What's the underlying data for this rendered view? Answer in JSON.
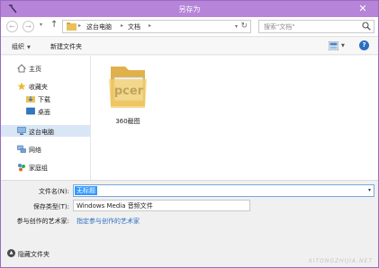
{
  "window": {
    "title": "另存为",
    "close_glyph": "✕"
  },
  "address": {
    "back_glyph": "←",
    "forward_glyph": "→",
    "dropdown_glyph": "▾",
    "up_glyph": "↑",
    "path": [
      "这台电脑",
      "文档"
    ],
    "separator_glyph": "▸",
    "refresh_glyph": "↻"
  },
  "search": {
    "placeholder": "搜索\"文档\""
  },
  "toolbar": {
    "organize": "组织",
    "new_folder": "新建文件夹",
    "caret_glyph": "▼",
    "help_glyph": "?"
  },
  "nav": {
    "favorites": [
      {
        "label": "主页",
        "icon": "home-icon"
      },
      {
        "label": "收藏夹",
        "icon": "star-icon"
      },
      {
        "label": "下载",
        "icon": "download-folder-icon"
      },
      {
        "label": "桌面",
        "icon": "desktop-icon"
      }
    ],
    "this_pc": "这台电脑",
    "network": "网络",
    "homegroup": "家庭组"
  },
  "files": [
    {
      "name": "360截图",
      "thumb_text": "pcer"
    }
  ],
  "form": {
    "filename_label": "文件名(N):",
    "filename_value": "无标题",
    "filetype_label": "保存类型(T):",
    "filetype_value": "Windows Media 音频文件",
    "authors_label": "参与创作的艺术家:",
    "authors_link": "指定参与创作的艺术家"
  },
  "footer": {
    "hide_folders": "隐藏文件夹",
    "hide_glyph": "▲",
    "watermark": "XITONGZHIJIA.NET"
  },
  "colors": {
    "titlebar": "#b684d8",
    "accent": "#2c6fbf",
    "selection": "#3399ff"
  }
}
